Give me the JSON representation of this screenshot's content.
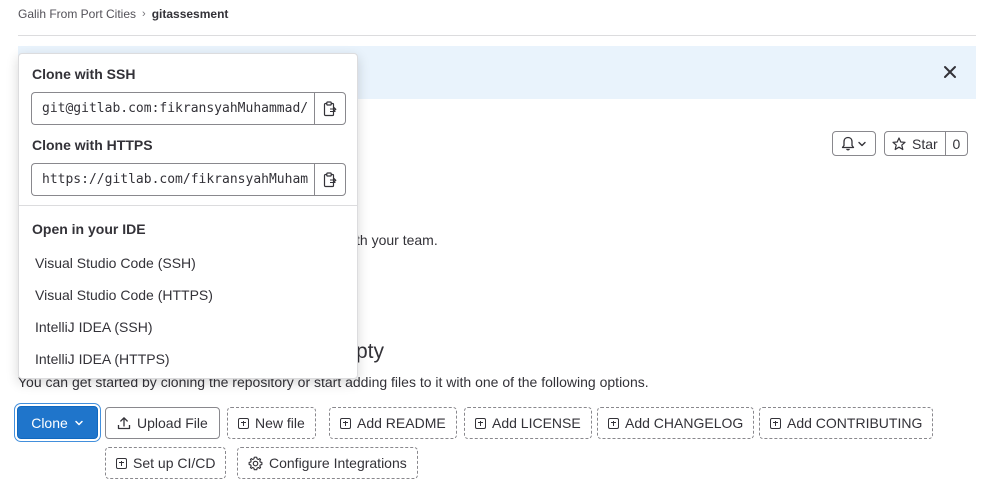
{
  "breadcrumb": {
    "group": "Galih From Port Cities",
    "separator": "›",
    "project": "gitassesment"
  },
  "header": {
    "star_label": "Star",
    "star_count": "0"
  },
  "description_fragment": "th your team.",
  "empty_repo": {
    "heading_fragment": "pty",
    "subtitle": "You can get started by cloning the repository or start adding files to it with one of the following options."
  },
  "actions": {
    "clone_label": "Clone",
    "upload_file": "Upload File",
    "new_file": "New file",
    "add_readme": "Add README",
    "add_license": "Add LICENSE",
    "add_changelog": "Add CHANGELOG",
    "add_contributing": "Add CONTRIBUTING",
    "setup_cicd": "Set up CI/CD",
    "configure_integrations": "Configure Integrations"
  },
  "clone_dropdown": {
    "ssh_label": "Clone with SSH",
    "ssh_url": "git@gitlab.com:fikransyahMuhammad/",
    "https_label": "Clone with HTTPS",
    "https_url": "https://gitlab.com/fikransyahMuham",
    "ide_label": "Open in your IDE",
    "ide_options": [
      "Visual Studio Code (SSH)",
      "Visual Studio Code (HTTPS)",
      "IntelliJ IDEA (SSH)",
      "IntelliJ IDEA (HTTPS)"
    ]
  },
  "colors": {
    "primary": "#1f75cb",
    "banner_bg": "#e9f3fc",
    "border": "#89888d",
    "text": "#333238"
  },
  "icons": [
    "chevron-right-icon",
    "close-icon",
    "bell-icon",
    "chevron-down-icon",
    "star-icon",
    "upload-icon",
    "square-plus-icon",
    "gear-icon",
    "clipboard-icon"
  ]
}
